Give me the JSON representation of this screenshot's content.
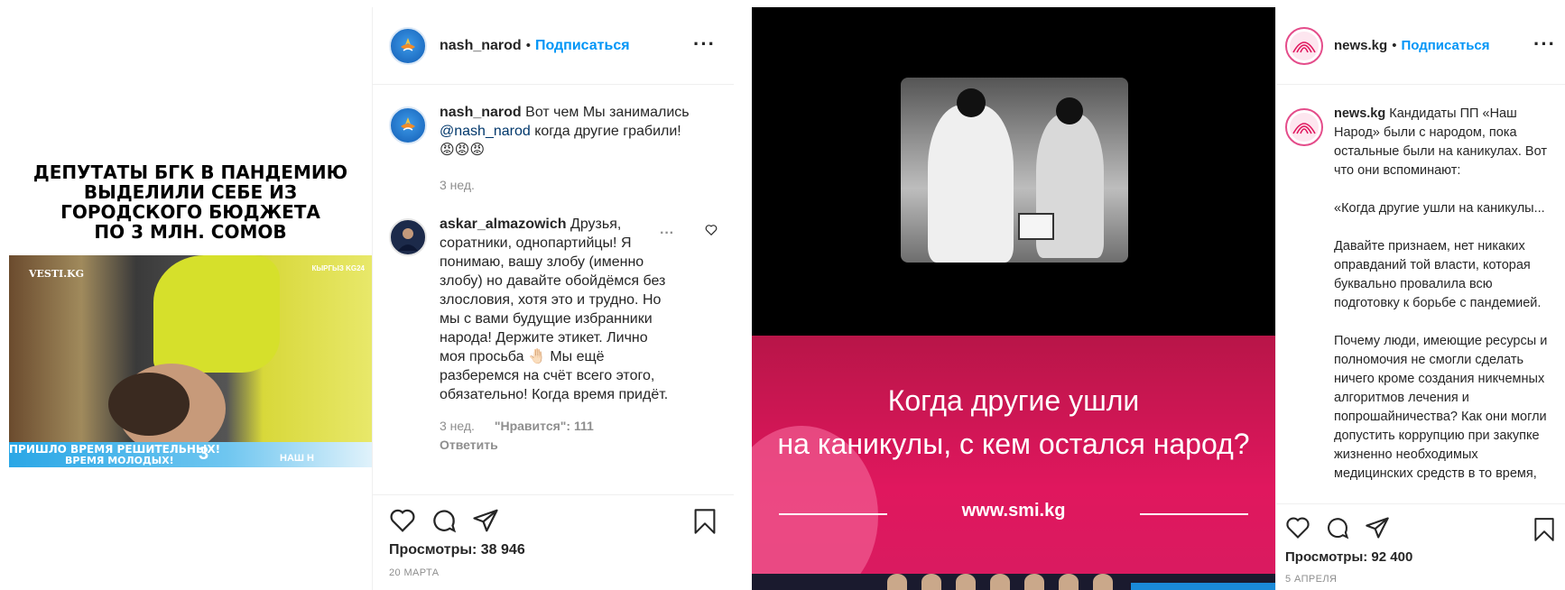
{
  "post1": {
    "media": {
      "headline_lines": [
        "ДЕПУТАТЫ БГК В ПАНДЕМИЮ",
        "ВЫДЕЛИЛИ СЕБЕ ИЗ",
        "ГОРОДСКОГО БЮДЖЕТА",
        "ПО 3 МЛН. СОМОВ"
      ],
      "logo_left": "VESTI.KG",
      "logo_right": "КЫРГЫЗ KG24",
      "strip_line1": "ПРИШЛО ВРЕМЯ РЕШИТЕЛЬНЫХ!",
      "strip_line2": "ВРЕМЯ МОЛОДЫХ!",
      "strip_number": "3",
      "strip_brand": "НАШ Н"
    },
    "header": {
      "username": "nash_narod",
      "separator": "•",
      "follow": "Подписаться"
    },
    "caption": {
      "username": "nash_narod",
      "text_before": "Вот чем Мы занимались",
      "mention": "@nash_narod",
      "text_after": "когда другие грабили!",
      "emojis": "😡😡😡",
      "time": "3 нед."
    },
    "comment": {
      "username": "askar_almazowich",
      "text": "Друзья, соратники, однопартийцы! Я понимаю, вашу злобу (именно злобу) но давайте обойдёмся без злословия, хотя это и трудно. Но мы с вами будущие избранники народа! Держите этикет. Лично моя просьба 🤚🏻 Мы ещё разберемся на счёт всего этого, обязательно! Когда время придёт.",
      "time": "3 нед.",
      "likes": "\"Нравится\": 111",
      "reply": "Ответить"
    },
    "views": "Просмотры: 38 946",
    "date": "20 МАРТА"
  },
  "post2": {
    "media": {
      "pink_line1": "Когда другие ушли",
      "pink_line2": "на каникулы, с кем остался народ?",
      "url": "www.smi.kg"
    },
    "header": {
      "username": "news.kg",
      "separator": "•",
      "follow": "Подписаться"
    },
    "caption": {
      "username": "news.kg",
      "p1": "Кандидаты ПП «Наш Народ» были с народом, пока остальные были на каникулах. Вот что они вспоминают:",
      "p2": "«Когда другие ушли на каникулы...",
      "p3": "Давайте признаем, нет никаких оправданий той власти, которая буквально провалила всю подготовку к борьбе с пандемией.",
      "p4": "Почему люди, имеющие ресурсы и полномочия не смогли сделать ничего кроме создания никчемных алгоритмов лечения и попрошайничества? Как они могли допустить коррупцию при закупке жизненно необходимых медицинских средств в то время,"
    },
    "views": "Просмотры: 92 400",
    "date": "5 АПРЕЛЯ"
  },
  "icons": [
    "heart-icon",
    "comment-icon",
    "share-icon",
    "bookmark-icon",
    "more-icon"
  ],
  "colors": {
    "follow": "#0095f6",
    "mention": "#00376b",
    "meta": "#8e8e8e",
    "pink": "#e0175e"
  }
}
